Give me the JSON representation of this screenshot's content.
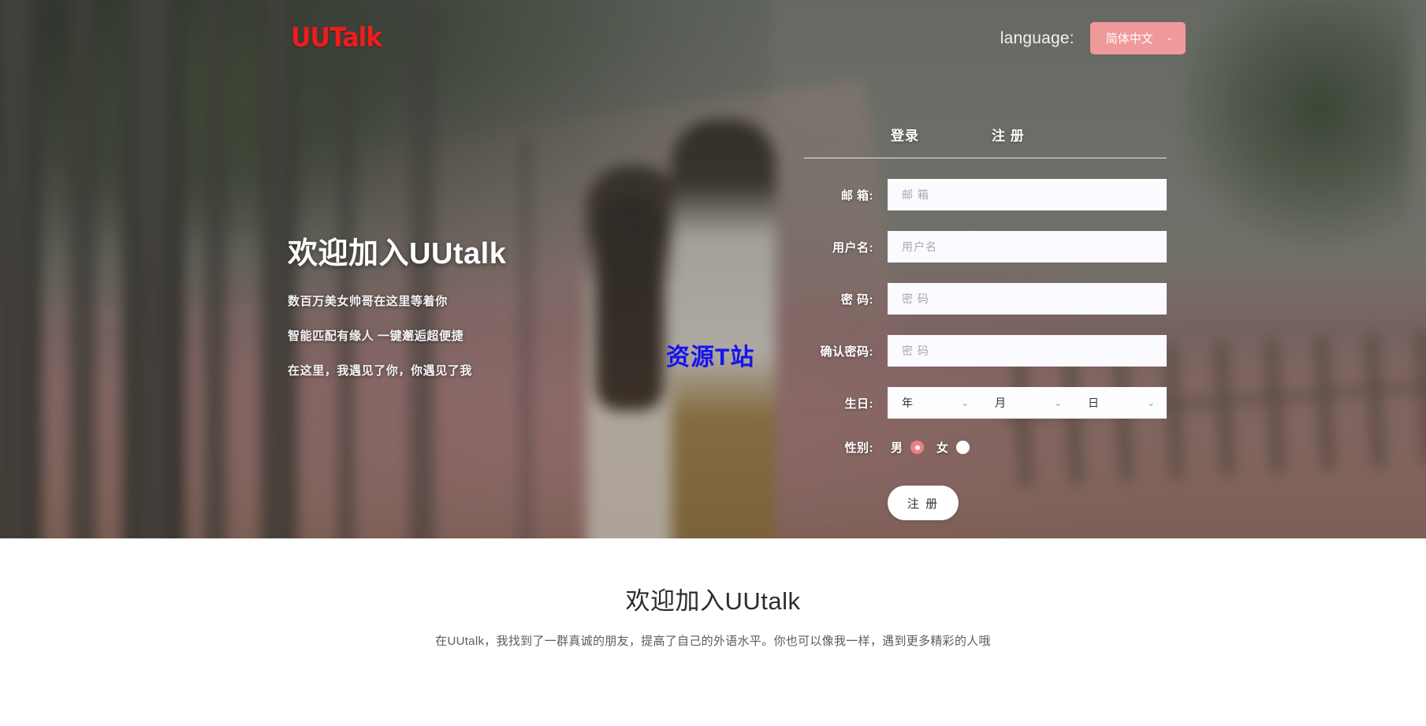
{
  "header": {
    "logo": "UUTalk",
    "language_label": "language:",
    "language_value": "简体中文",
    "chevron": "⌄"
  },
  "hero": {
    "title": "欢迎加入UUtalk",
    "lines": [
      "数百万美女帅哥在这里等着你",
      "智能匹配有缘人 一键邂逅超便捷",
      "在这里，我遇见了你，你遇见了我"
    ],
    "watermark": "资源T站"
  },
  "form": {
    "tabs": [
      {
        "label": "登录",
        "active": false
      },
      {
        "label": "注 册",
        "active": true
      }
    ],
    "fields": [
      {
        "label": "邮 箱:",
        "placeholder": "邮 箱",
        "value": "",
        "type": "email"
      },
      {
        "label": "用户名:",
        "placeholder": "用户名",
        "value": "",
        "type": "text"
      },
      {
        "label": "密 码:",
        "placeholder": "密 码",
        "value": "",
        "type": "password"
      },
      {
        "label": "确认密码:",
        "placeholder": "密 码",
        "value": "",
        "type": "password"
      }
    ],
    "birthday": {
      "label": "生日:",
      "year": "年",
      "month": "月",
      "day": "日",
      "chevron": "⌄"
    },
    "gender": {
      "label": "性别:",
      "male": "男",
      "female": "女",
      "selected": "男"
    },
    "submit_label": "注 册"
  },
  "bottom": {
    "title": "欢迎加入UUtalk",
    "description": "在UUtalk，我找到了一群真诚的朋友，提高了自己的外语水平。你也可以像我一样，遇到更多精彩的人哦"
  },
  "colors": {
    "accent": "#f0999b",
    "radio_selected": "#f07f88",
    "logo_red": "#ef1c1c",
    "watermark_blue": "#1414f0"
  }
}
